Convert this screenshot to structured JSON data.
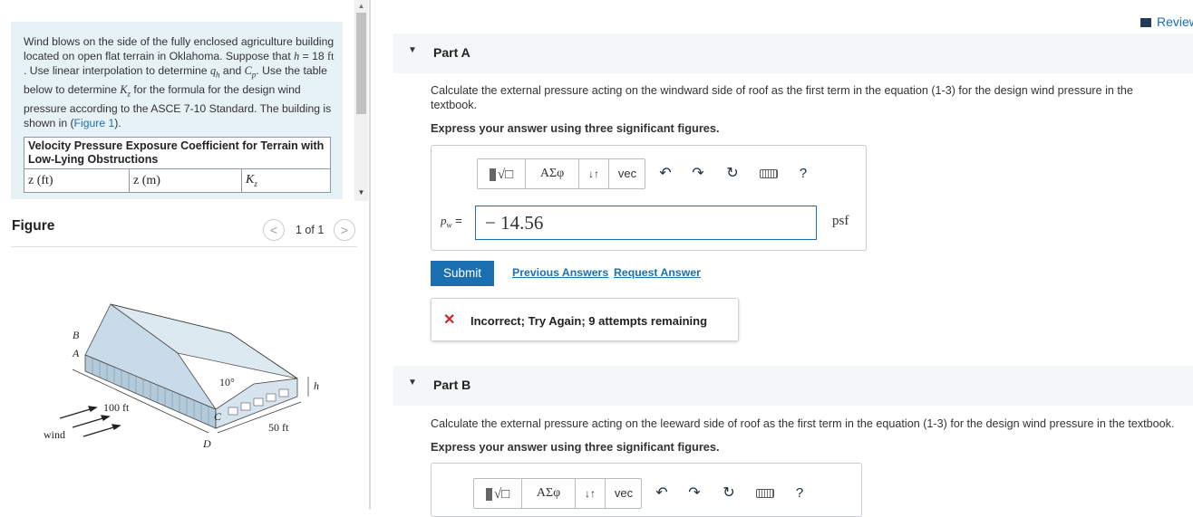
{
  "problem": {
    "text_1": "Wind blows on the side of the fully enclosed agriculture building located on open flat terrain in Oklahoma. Suppose that ",
    "h_sym": "h",
    "text_2": " = 18 ",
    "ft": "ft",
    "text_3": " . Use linear interpolation to determine ",
    "qh_sym": "q",
    "qh_sub": "h",
    "text_4": " and ",
    "cp_sym": "C",
    "cp_sub": "p",
    "text_5": ". Use the table below to determine ",
    "kz_sym": "K",
    "kz_sub": "z",
    "text_6": " for the formula for the design wind pressure according to the ASCE 7-10 Standard. The building is shown in (",
    "figure_link": "Figure 1",
    "text_7": ")."
  },
  "table": {
    "caption": "Velocity Pressure Exposure Coefficient for Terrain with Low-Lying Obstructions",
    "col_1": "z (ft)",
    "col_2": "z (m)",
    "col_3_sym": "K",
    "col_3_sub": "z"
  },
  "figure": {
    "title": "Figure",
    "pager": "1 of 1",
    "prev_icon": "chevron-left",
    "next_icon": "chevron-right",
    "labels": {
      "b": "B",
      "a": "A",
      "c": "C",
      "d": "D",
      "angle": "10°",
      "h": "h",
      "length": "100 ft",
      "width": "50 ft",
      "wind": "wind"
    }
  },
  "header": {
    "review": "Review"
  },
  "part_a": {
    "label": "Part A",
    "question": "Calculate the external pressure acting on the windward side of roof as the first term in the equation (1-3) for the design wind pressure in the textbook.",
    "instruction": "Express your answer using three significant figures.",
    "toolbar": {
      "greek": "ΑΣφ",
      "updown": "↓↑",
      "vec": "vec",
      "help": "?"
    },
    "var_label": "pw =",
    "var_sym": "p",
    "var_sub": "w",
    "answer": "− 14.56",
    "unit": "psf",
    "submit": "Submit",
    "previous_answers": "Previous Answers",
    "request_answer": "Request Answer",
    "feedback_icon": "✕",
    "feedback": "Incorrect; Try Again; 9 attempts remaining"
  },
  "part_b": {
    "label": "Part B",
    "question": "Calculate the external pressure acting on the leeward side of roof as the first term in the equation (1-3) for the design wind pressure in the textbook.",
    "instruction": "Express your answer using three significant figures.",
    "toolbar": {
      "greek": "ΑΣφ",
      "updown": "↓↑",
      "vec": "vec",
      "help": "?"
    }
  },
  "colors": {
    "accent": "#1a6fb0",
    "error": "#c9272e",
    "panel": "#e6f2f6"
  }
}
